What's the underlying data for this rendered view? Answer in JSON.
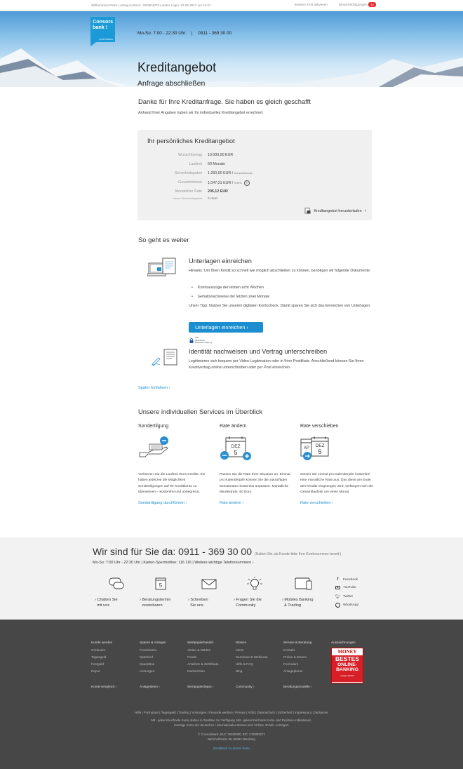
{
  "topbar": {
    "welcome": "Willkommen Peter Ludwig   Kontonr.: 920504370   Letzter Login: 22.06.2017 um 14:01",
    "session": "Session-TAN aktivieren",
    "notifications": "Benachrichtigungen",
    "notif_count": "12"
  },
  "logo": {
    "line1": "Consors",
    "line2": "bank !",
    "tag": "by BNP PARIBAS"
  },
  "hero": {
    "hours": "Mo-So: 7:00 - 22:30 Uhr",
    "phone": "0911 - 369 30 00",
    "title": "Kreditangebot",
    "subtitle": "Anfrage abschließen"
  },
  "thanks": {
    "title": "Danke für Ihre Kreditanfrage. Sie haben es gleich geschafft",
    "text": "Anhand Ihrer Angaben haben wir Ihr individuelles Kreditangebot errechnet:"
  },
  "offer": {
    "title": "Ihr persönliches Kreditangebot",
    "rows": [
      {
        "k": "Wunschbetrag",
        "v": "10.000,00 EUR",
        "s": ""
      },
      {
        "k": "Laufzeit",
        "v": "60 Monate",
        "s": ""
      },
      {
        "k": "Sicherheitspaket",
        "v": "1.260,00 EUR /",
        "s": "Komplettschutz"
      },
      {
        "k": "Gesamtzinsen",
        "v": "1.047,21 EUR /",
        "s": "3,99%"
      },
      {
        "k": "Monatliche Rate",
        "v": "205,12 EUR",
        "s": ""
      },
      {
        "k": "davon Sicherheitspaket",
        "v": "21 EUR",
        "s": ""
      }
    ],
    "info": "i",
    "download": "Kreditangebot herunterladen"
  },
  "next": {
    "title": "So geht es weiter",
    "step1_title": "Unterlagen einreichen",
    "step1_text": "Hinweis: Um Ihren Kredit so schnell wie möglich abschließen zu können, benötigen wir folgende Dokumente:",
    "bullets": [
      "Kontoauszüge der letzten acht Wochen",
      "Gehaltsnachweise der letzten zwei Monate"
    ],
    "tip": "Unser Tipp: Nutzen Sie unseren digitalen Kontocheck. Damit sparen Sie sich das Einreichen von Unterlagen.",
    "button": "Unterlagen einreichen",
    "ssl": "SSL gesicherte Datenübertragung",
    "step2_title": "Identität nachweisen und Vertrag unterschreiben",
    "step2_text": "Legitimieren sich bequem per Video-Legitimation oder in Ihrer Postfiliale. Anschließend können Sie Ihren Kreditvertrag online unterschreiben oder per Post einreichen.",
    "later": "Später fortfahren"
  },
  "services": {
    "title": "Unsere individuellen Services im Überblick",
    "items": [
      {
        "h": "Sondertilgung",
        "p": "Verkürzen Sie die Laufzeit Ihres Kredits: Sie haben jederzeit die Möglichkeit Sondertilgungen auf Ihr Kreditkonto zu überweisen – kostenfrei und unbegrenzt.",
        "link": "Sondertilgung durchführen"
      },
      {
        "h": "Rate ändern",
        "p": "Passen Sie die Rate Ihrer Situation an: Einmal pro Kalenderjahr können Sie die zukünftigen Monatsraten kostenlos anpassen. Monatliche Mindestrate: 50 Euro.",
        "link": "Rate ändern",
        "cal1": "DEZ",
        "cal2": "5"
      },
      {
        "h": "Rate verschieben",
        "p": "Setzen Sie einmal pro Kalenderjahr kostenfrei eine monatliche Rate aus. Das diese am Ende des Kredits eingezogen wird, verlängert sich die Gesamtlaufzeit um einen Monat.",
        "link": "Rate verschieben",
        "cal1": "AP",
        "cal2": "DEZ",
        "cal3": "5"
      }
    ]
  },
  "contact": {
    "title": "Wir sind für Sie da: 0911 - 369 30 00",
    "hint": "(Halten Sie als Kunde bitte Ihre Kontonummer bereit.)",
    "sub": "Mo-So: 7:00 Uhr - 22:30 Uhr  |  Karten-Sperrhotline: 116 116  |  Weitere wichtige Telefonnummern",
    "items": [
      {
        "l1": "Chatten Sie",
        "l2": "mit uns"
      },
      {
        "l1": "Beratungstermin",
        "l2": "vereinbaren",
        "cal": "5"
      },
      {
        "l1": "Schreiben",
        "l2": "Sie uns"
      },
      {
        "l1": "Fragen Sie die",
        "l2": "Community"
      },
      {
        "l1": "Mobiles Banking",
        "l2": "& Trading"
      }
    ],
    "social": [
      "Facebook",
      "YouTube",
      "Twitter",
      "WhatsApp"
    ]
  },
  "footer": {
    "cols": [
      {
        "h": "Kunde werden",
        "items": [
          "Girokonto",
          "Tagesgeld",
          "Festgeld",
          "Depot"
        ],
        "bottom": "Kontenvergleich"
      },
      {
        "h": "Sparen & Anlegen",
        "items": [
          "FondsStars",
          "Sparbrief",
          "Sparpläne",
          "Vorsorgen"
        ],
        "bottom": "Anlageideen"
      },
      {
        "h": "Wertpapierhandel",
        "items": [
          "Aktien & Märkte",
          "Fonds",
          "Anleihen & Zertifikate",
          "Nachrichten"
        ],
        "bottom": "Wertpapierdepot"
      },
      {
        "h": "Wissen",
        "items": [
          "Ideen",
          "Seminare & Webinare",
          "Hilfe & FAQ",
          "Blog"
        ],
        "bottom": "Community"
      },
      {
        "h": "Service & Beratung",
        "items": [
          "Kontakt",
          "Preise & Zinsen",
          "Formulare",
          "Anlageplaner"
        ],
        "bottom": "Beratungsmodelle"
      },
      {
        "h": "Auszeichnungen",
        "items": [],
        "bottom": ""
      }
    ],
    "award": {
      "mag": "MONEY",
      "l1": "BESTES",
      "l2": "ONLINE-",
      "l3": "BANKING",
      "l4": "Ausgabe 03/2016"
    },
    "links": "Hilfe  |  Formulare  |  Tagesgeld  |  Trading  |  Vorsorgen  |  Freunde werben  |  Presse  |  AGB  |  Datenschutz  |  Sicherheit  |  Impressum  |  Disclaimer",
    "note1": "Mit - gekennzeichnete Kurse stehen in Realtime zur Verfügung. Mit - gekennzeichnete Kurse sind Realtime-Indikationen.",
    "note2": "Sonstige Kurse der deutschen / internationalen Börsen sind 15 bzw. 20 Min. verzögert.",
    "copy": "© Consorsbank, BLZ: 76030080, BIC: CSDBDE71",
    "addr": "Bahnhofstraße 55, 90402 Nürnberg",
    "feedback": "Feedback zu dieser Seite"
  }
}
